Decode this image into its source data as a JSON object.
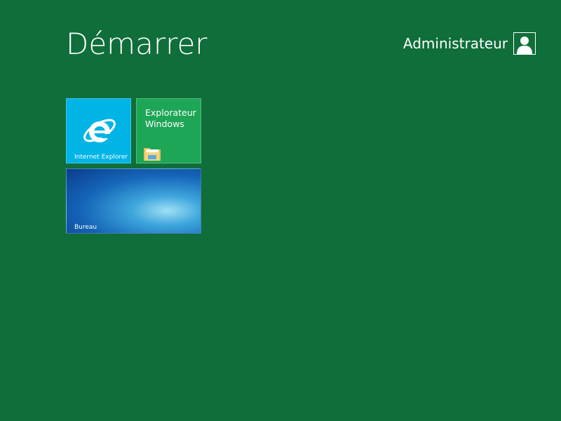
{
  "header": {
    "title": "Démarrer",
    "user_name": "Administrateur"
  },
  "tiles": [
    {
      "label": "Internet Explorer",
      "icon": "internet-explorer-icon"
    },
    {
      "label_line1": "Explorateur",
      "label_line2": "Windows",
      "icon": "folder-icon"
    },
    {
      "label": "Bureau",
      "icon": "desktop-wallpaper"
    }
  ],
  "colors": {
    "background": "#0f6e3a",
    "ie_tile": "#00b4e6",
    "explorer_tile": "#1ea657"
  }
}
